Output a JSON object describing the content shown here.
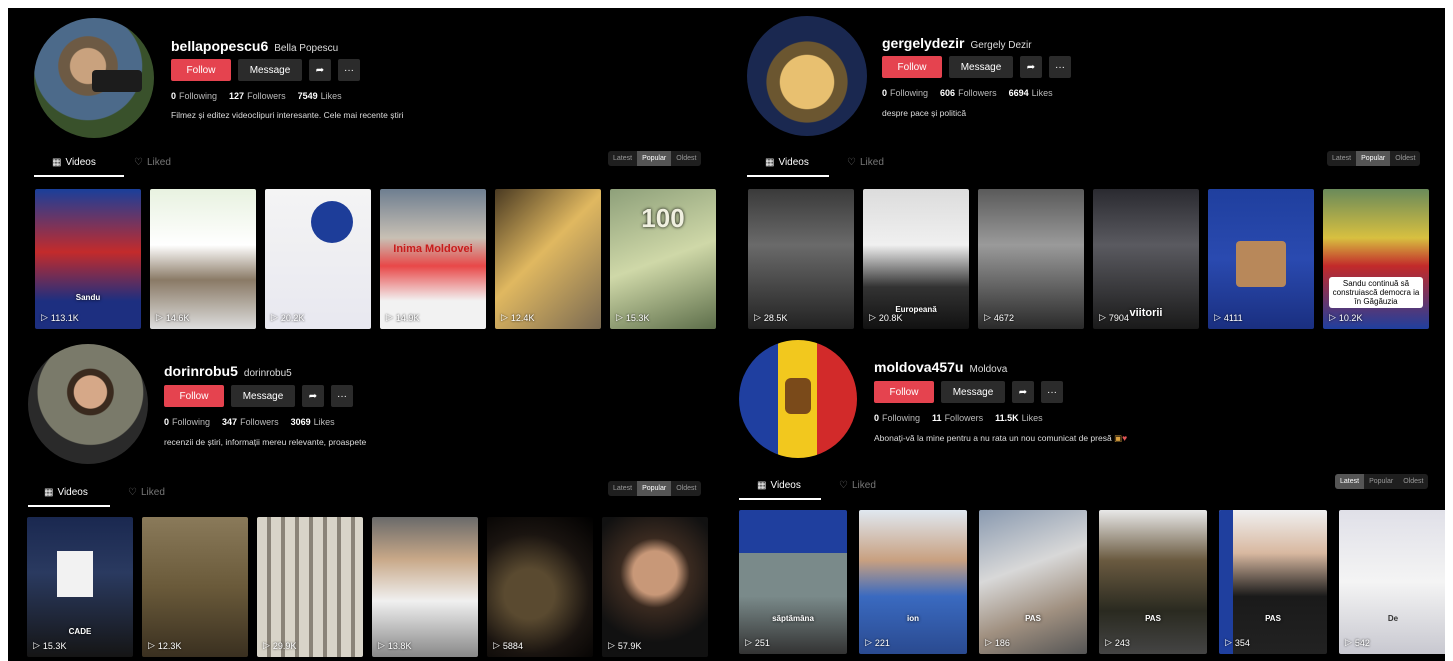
{
  "ui": {
    "follow": "Follow",
    "message": "Message",
    "share_icon": "share-icon",
    "more": "···",
    "following": "Following",
    "followers": "Followers",
    "likes": "Likes",
    "tab_videos": "Videos",
    "tab_liked": "Liked",
    "latest": "Latest",
    "popular": "Popular",
    "oldest": "Oldest"
  },
  "p1": {
    "username": "bellapopescu6",
    "display": "Bella Popescu",
    "following": "0",
    "followers": "127",
    "likes": "7549",
    "bio": "Filmez și editez videoclipuri interesante. Cele mai recente știri",
    "videos": [
      {
        "views": "113.1K",
        "cap": "Sandu"
      },
      {
        "views": "14.6K"
      },
      {
        "views": "20.2K"
      },
      {
        "views": "14.9K",
        "cap": "Inima Moldovei"
      },
      {
        "views": "12.4K"
      },
      {
        "views": "15.3K",
        "cap": "100"
      }
    ]
  },
  "p2": {
    "username": "gergelydezir",
    "display": "Gergely Dezir",
    "following": "0",
    "followers": "606",
    "likes": "6694",
    "bio": "despre pace și politică",
    "videos": [
      {
        "views": "28.5K"
      },
      {
        "views": "20.8K",
        "cap": "Europeană"
      },
      {
        "views": "4672"
      },
      {
        "views": "7904",
        "cap": "viitorii"
      },
      {
        "views": "4111"
      },
      {
        "views": "10.2K",
        "cap": "Sandu continuă să construiască democra ia în Găgăuzia"
      }
    ]
  },
  "p3": {
    "username": "dorinrobu5",
    "display": "dorinrobu5",
    "following": "0",
    "followers": "347",
    "likes": "3069",
    "bio": "recenzii de știri, informații mereu relevante, proaspete",
    "videos": [
      {
        "views": "15.3K",
        "cap": "CADE"
      },
      {
        "views": "12.3K"
      },
      {
        "views": "29.9K"
      },
      {
        "views": "13.8K"
      },
      {
        "views": "5884"
      },
      {
        "views": "57.9K"
      }
    ]
  },
  "p4": {
    "username": "moldova457u",
    "display": "Moldova",
    "following": "0",
    "followers": "11",
    "likes": "11.5K",
    "bio": "Abonați-vă la mine pentru a nu rata un nou comunicat de presă",
    "videos": [
      {
        "views": "251",
        "cap": "săptămâna"
      },
      {
        "views": "221",
        "cap": "ion"
      },
      {
        "views": "186",
        "cap": "PAS"
      },
      {
        "views": "243",
        "cap": "PAS"
      },
      {
        "views": "354",
        "cap": "PAS"
      },
      {
        "views": "542",
        "cap": "De"
      }
    ]
  }
}
